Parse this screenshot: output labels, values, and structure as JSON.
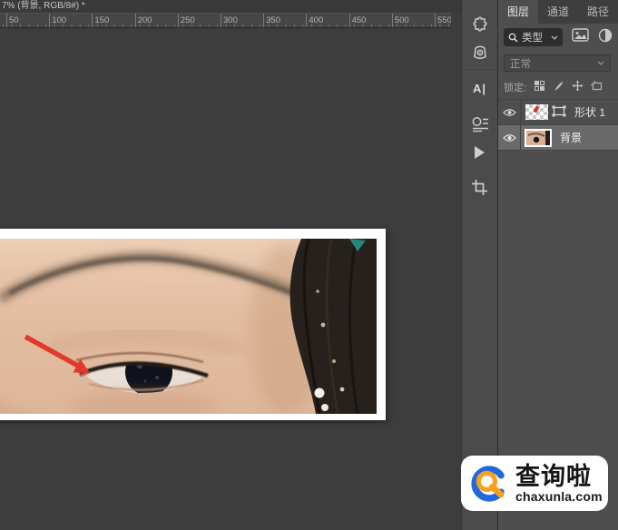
{
  "window": {
    "title": "7% (背景, RGB/8#) *"
  },
  "ruler": {
    "labels": [
      "50",
      "100",
      "150",
      "200",
      "250",
      "300",
      "350",
      "400",
      "450",
      "500",
      "550"
    ]
  },
  "dock": {
    "character_label": "A|",
    "panels": [
      "extensions",
      "color-themes",
      "character",
      "paragraph",
      "actions",
      "crop"
    ]
  },
  "layers_panel": {
    "tabs": [
      {
        "label": "图层",
        "active": true
      },
      {
        "label": "通道",
        "active": false
      },
      {
        "label": "路径",
        "active": false
      }
    ],
    "filter": {
      "search_label": "类型"
    },
    "blend_mode": {
      "value": "正常"
    },
    "lock_label": "锁定:",
    "layers": [
      {
        "name": "形状 1",
        "visible": true,
        "selected": false
      },
      {
        "name": "背景",
        "visible": true,
        "selected": true
      }
    ]
  },
  "canvas": {
    "annotation": "red-arrow",
    "arrow_color": "#e2392b"
  },
  "watermark": {
    "title": "查询啦",
    "domain": "chaxunla.com",
    "brand_blue": "#2268dd",
    "brand_orange": "#f6a01e"
  }
}
